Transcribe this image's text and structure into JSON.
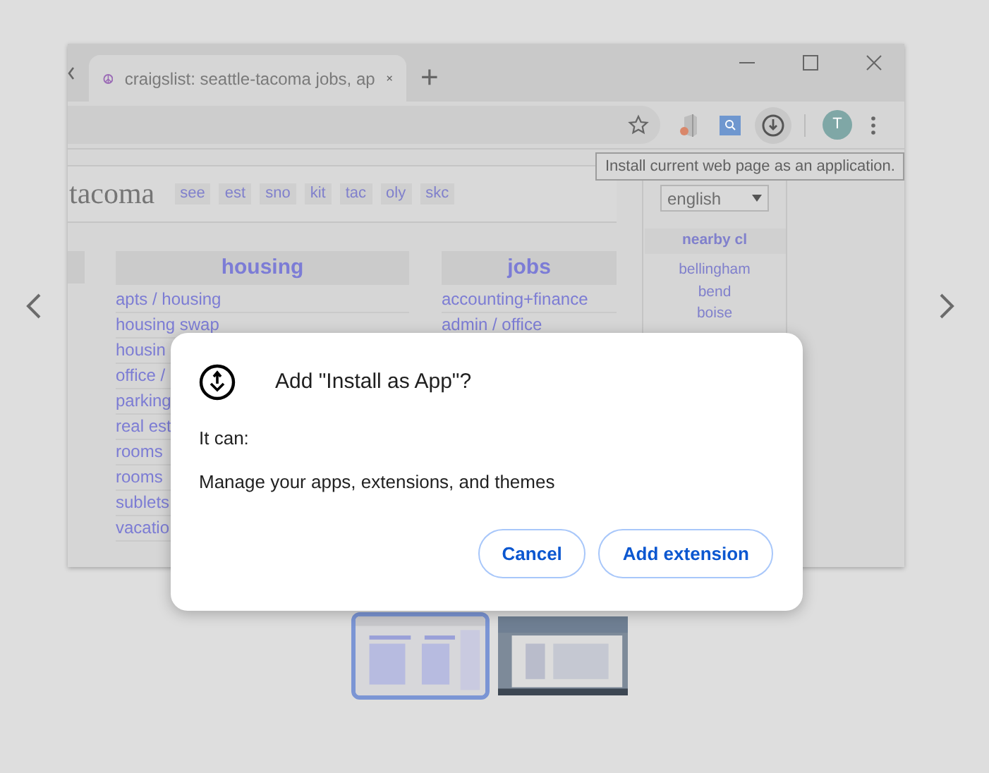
{
  "browser": {
    "tab": {
      "title": "craigslist: seattle-tacoma jobs, ap"
    },
    "new_tab": "+",
    "avatar": "T",
    "tooltip": "Install current web page as an application."
  },
  "page": {
    "site": "tacoma",
    "area_links": [
      "see",
      "est",
      "sno",
      "kit",
      "tac",
      "oly",
      "skc"
    ],
    "language": "english",
    "sections": [
      {
        "title": "housing",
        "links": [
          "apts / housing",
          "housing swap",
          "housin",
          "office /",
          "parking",
          "real est",
          "rooms",
          "rooms",
          "sublets",
          "vacatio"
        ]
      },
      {
        "title": "jobs",
        "links": [
          "accounting+finance",
          "admin / office"
        ]
      }
    ],
    "nearby": {
      "title": "nearby cl",
      "cities": [
        "bellingham",
        "bend",
        "boise"
      ]
    }
  },
  "dialog": {
    "title": "Add \"Install as App\"?",
    "intro": "It can:",
    "permission": "Manage your apps, extensions, and themes",
    "buttons": [
      "Cancel",
      "Add extension"
    ]
  },
  "thumbnails": [
    {
      "kind": "picture",
      "selected": true
    },
    {
      "kind": "picture",
      "selected": false
    }
  ]
}
